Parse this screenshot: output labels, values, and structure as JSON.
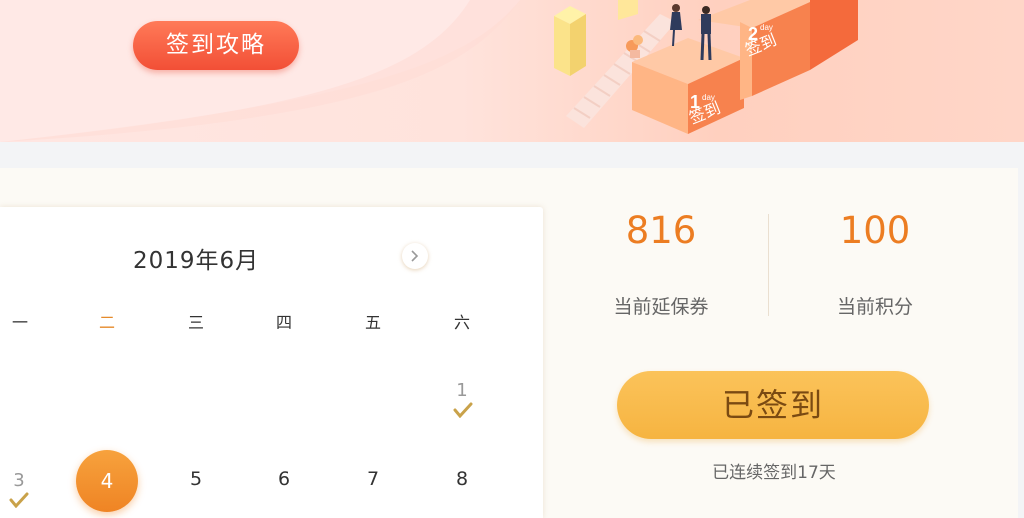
{
  "banner": {
    "strategy_button": "签到攻略",
    "step1_num": "1",
    "step1_day": "day",
    "step1_label": "签到",
    "step2_num": "2",
    "step2_day": "day",
    "step2_label": "签到"
  },
  "calendar": {
    "title": "2019年6月",
    "weekdays": [
      "一",
      "二",
      "三",
      "四",
      "五",
      "六"
    ],
    "today_weekday_index": 1,
    "row1": [
      {
        "day": "1",
        "signed": true
      }
    ],
    "row2": [
      {
        "day": "3",
        "signed": true
      },
      {
        "day": "4",
        "today": true
      },
      {
        "day": "5"
      },
      {
        "day": "6"
      },
      {
        "day": "7"
      },
      {
        "day": "8"
      }
    ]
  },
  "stats": {
    "coupons_value": "816",
    "coupons_label": "当前延保券",
    "points_value": "100",
    "points_label": "当前积分"
  },
  "signin": {
    "button_label": "已签到",
    "streak_text": "已连续签到17天"
  },
  "colors": {
    "accent_orange": "#ec7d22",
    "button_red": "#f24f36",
    "signed_yellow": "#f6b441",
    "check_gold": "#c9a24a"
  }
}
